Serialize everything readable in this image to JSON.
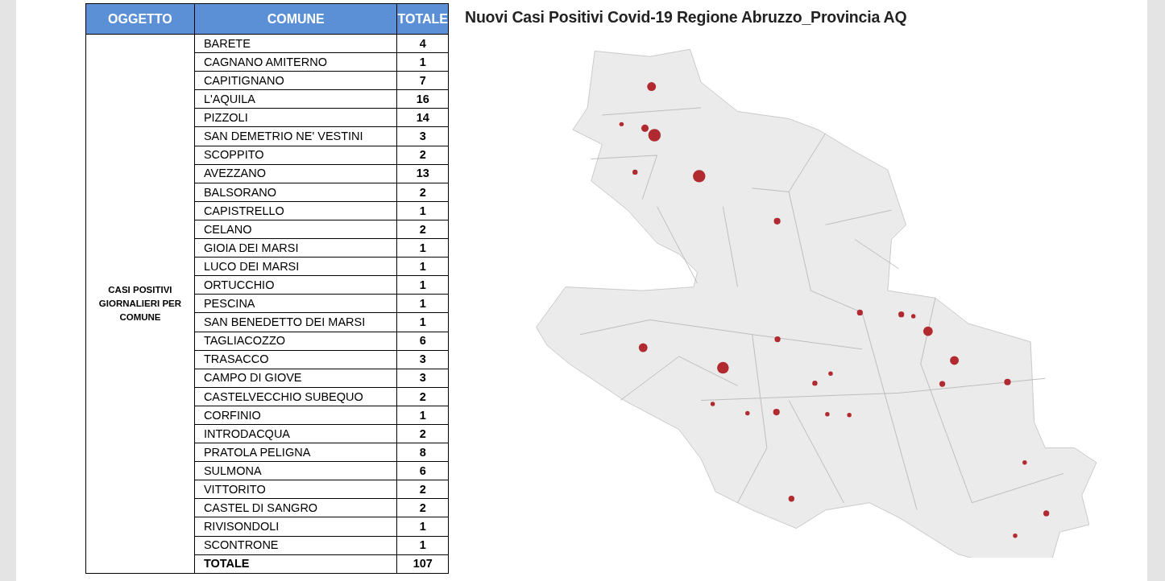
{
  "table": {
    "columns": [
      "OGGETTO",
      "COMUNE",
      "TOTALE"
    ],
    "group_label": "CASI POSITIVI GIORNALIERI PER COMUNE",
    "rows": [
      {
        "comune": "BARETE",
        "totale": "4"
      },
      {
        "comune": "CAGNANO AMITERNO",
        "totale": "1"
      },
      {
        "comune": "CAPITIGNANO",
        "totale": "7"
      },
      {
        "comune": "L'AQUILA",
        "totale": "16"
      },
      {
        "comune": "PIZZOLI",
        "totale": "14"
      },
      {
        "comune": "SAN DEMETRIO NE' VESTINI",
        "totale": "3"
      },
      {
        "comune": "SCOPPITO",
        "totale": "2"
      },
      {
        "comune": "AVEZZANO",
        "totale": "13"
      },
      {
        "comune": "BALSORANO",
        "totale": "2"
      },
      {
        "comune": "CAPISTRELLO",
        "totale": "1"
      },
      {
        "comune": "CELANO",
        "totale": "2"
      },
      {
        "comune": "GIOIA DEI MARSI",
        "totale": "1"
      },
      {
        "comune": "LUCO DEI MARSI",
        "totale": "1"
      },
      {
        "comune": "ORTUCCHIO",
        "totale": "1"
      },
      {
        "comune": "PESCINA",
        "totale": "1"
      },
      {
        "comune": "SAN BENEDETTO DEI MARSI",
        "totale": "1"
      },
      {
        "comune": "TAGLIACOZZO",
        "totale": "6"
      },
      {
        "comune": "TRASACCO",
        "totale": "3"
      },
      {
        "comune": "CAMPO DI GIOVE",
        "totale": "3"
      },
      {
        "comune": "CASTELVECCHIO SUBEQUO",
        "totale": "2"
      },
      {
        "comune": "CORFINIO",
        "totale": "1"
      },
      {
        "comune": "INTRODACQUA",
        "totale": "2"
      },
      {
        "comune": "PRATOLA PELIGNA",
        "totale": "8"
      },
      {
        "comune": "SULMONA",
        "totale": "6"
      },
      {
        "comune": "VITTORITO",
        "totale": "2"
      },
      {
        "comune": "CASTEL DI SANGRO",
        "totale": "2"
      },
      {
        "comune": "RIVISONDOLI",
        "totale": "1"
      },
      {
        "comune": "SCONTRONE",
        "totale": "1"
      }
    ],
    "total": {
      "label": "TOTALE",
      "value": "107"
    }
  },
  "map": {
    "title": "Nuovi Casi Positivi Covid-19 Regione Abruzzo_Provincia AQ"
  }
}
